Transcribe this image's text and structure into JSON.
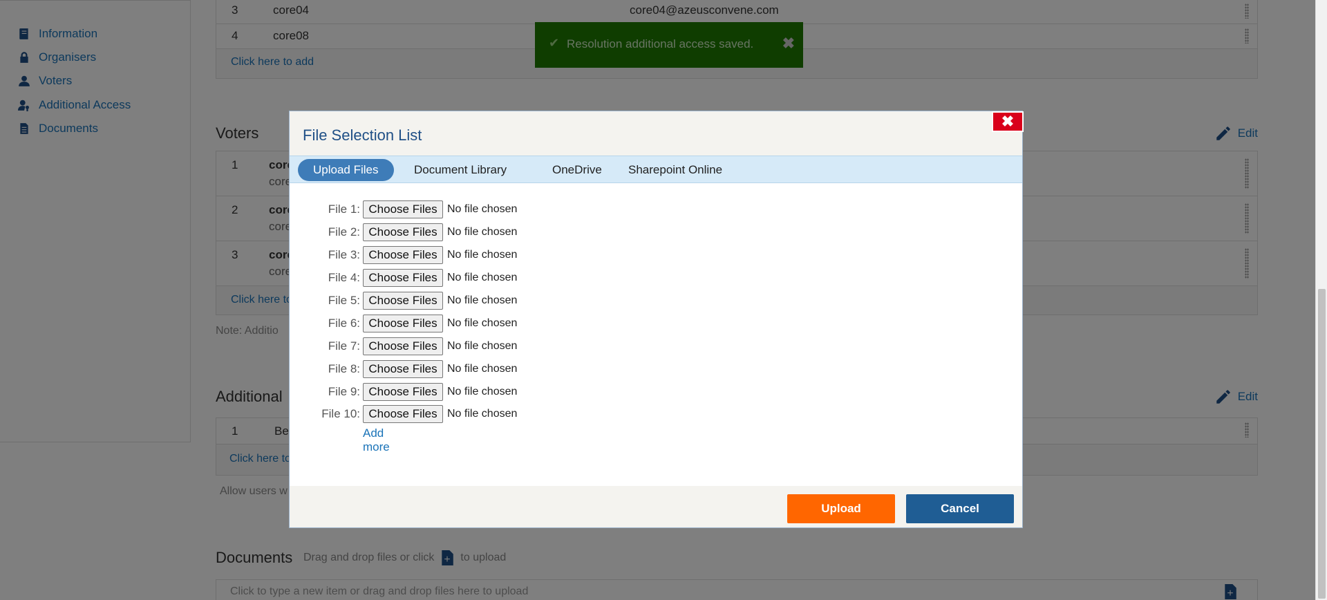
{
  "sidebar": {
    "items": [
      {
        "label": "Information",
        "icon": "book-icon"
      },
      {
        "label": "Organisers",
        "icon": "lock-icon"
      },
      {
        "label": "Voters",
        "icon": "user-icon"
      },
      {
        "label": "Additional Access",
        "icon": "user-key-icon"
      },
      {
        "label": "Documents",
        "icon": "document-icon"
      }
    ]
  },
  "organisers": {
    "rows": [
      {
        "num": "3",
        "name": "core04",
        "email": "core04@azeusconvene.com"
      },
      {
        "num": "4",
        "name": "core08",
        "email": ""
      }
    ],
    "add_label": "Click here to add"
  },
  "voters": {
    "title": "Voters",
    "edit_label": "Edit",
    "rows": [
      {
        "num": "1",
        "name": "core",
        "sub": "core"
      },
      {
        "num": "2",
        "name": "core",
        "sub": "core"
      },
      {
        "num": "3",
        "name": "core",
        "sub": "core"
      }
    ],
    "add_label": "Click here to",
    "note": "Note: Additio"
  },
  "additional": {
    "title": "Additional",
    "edit_label": "Edit",
    "rows": [
      {
        "num": "1",
        "name": "Bee"
      }
    ],
    "add_label": "Click here to",
    "note": "Allow users w"
  },
  "documents": {
    "title": "Documents",
    "hint_before": "Drag and drop files or click",
    "hint_after": "to upload",
    "placeholder": "Click to type a new item or drag and drop files here to upload"
  },
  "toast": {
    "message": "Resolution additional access saved.",
    "color": "#1f7a00"
  },
  "modal": {
    "title": "File Selection List",
    "tabs": [
      "Upload Files",
      "Document Library",
      "OneDrive",
      "Sharepoint Online"
    ],
    "active_tab": "Upload Files",
    "files": [
      {
        "label": "File 1:",
        "button": "Choose Files",
        "status": "No file chosen"
      },
      {
        "label": "File 2:",
        "button": "Choose Files",
        "status": "No file chosen"
      },
      {
        "label": "File 3:",
        "button": "Choose Files",
        "status": "No file chosen"
      },
      {
        "label": "File 4:",
        "button": "Choose Files",
        "status": "No file chosen"
      },
      {
        "label": "File 5:",
        "button": "Choose Files",
        "status": "No file chosen"
      },
      {
        "label": "File 6:",
        "button": "Choose Files",
        "status": "No file chosen"
      },
      {
        "label": "File 7:",
        "button": "Choose Files",
        "status": "No file chosen"
      },
      {
        "label": "File 8:",
        "button": "Choose Files",
        "status": "No file chosen"
      },
      {
        "label": "File 9:",
        "button": "Choose Files",
        "status": "No file chosen"
      },
      {
        "label": "File 10:",
        "button": "Choose Files",
        "status": "No file chosen"
      }
    ],
    "add_more": "Add more",
    "upload_label": "Upload",
    "cancel_label": "Cancel",
    "upload_color": "#ff6600",
    "cancel_color": "#1f5d94"
  }
}
